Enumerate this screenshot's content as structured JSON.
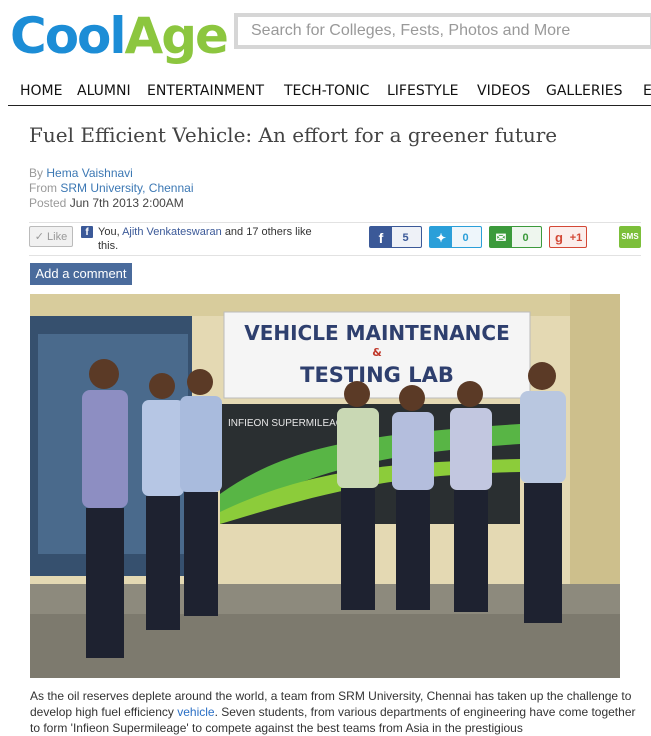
{
  "logo": {
    "part1": "Cool",
    "part2": "Age"
  },
  "search": {
    "placeholder": "Search for Colleges, Fests, Photos and More"
  },
  "nav": [
    "HOME",
    "ALUMNI",
    "ENTERTAINMENT",
    "TECH-TONIC",
    "LIFESTYLE",
    "VIDEOS",
    "GALLERIES",
    "E"
  ],
  "article": {
    "title": "Fuel Efficient Vehicle: An effort for a greener future",
    "by_label": "By",
    "author": "Hema Vaishnavi",
    "from_label": "From",
    "institution": "SRM University, Chennai",
    "posted_label": "Posted",
    "date": "Jun 7th 2013 2:00AM"
  },
  "social": {
    "like_button": "Like",
    "like_prefix": "You,",
    "like_person": "Ajith Venkateswaran",
    "like_suffix": "and 17 others like this.",
    "facebook_count": "5",
    "twitter_count": "0",
    "email_count": "0",
    "gplus_count": "+1",
    "sms_label": "SMS",
    "colors": {
      "facebook": "#3b5998",
      "twitter": "#2b9fd9",
      "email": "#3c9a3c",
      "gplus": "#d34836",
      "sms": "#7cbf3a"
    }
  },
  "comment_button": "Add a comment",
  "photo": {
    "sign_line1": "VEHICLE MAINTENANCE",
    "sign_amp": "&",
    "sign_line2": "TESTING LAB",
    "banner_text": "INFIEON SUPERMILEAGE"
  },
  "body": {
    "text1": "As the oil reserves deplete around the world, a team from SRM University, Chennai has taken up the challenge to develop high fuel efficiency ",
    "link": "vehicle",
    "text2": ". Seven students, from various departments of engineering have come together to form 'Infieon Supermileage' to compete against the best teams from Asia in the prestigious"
  }
}
